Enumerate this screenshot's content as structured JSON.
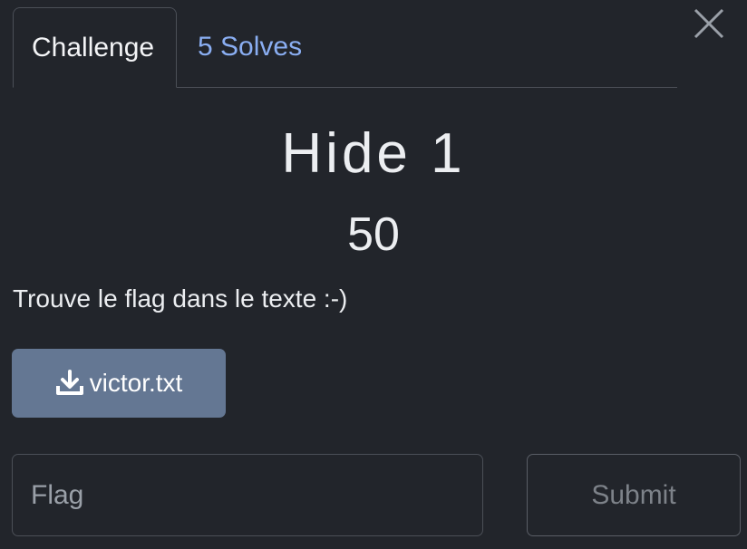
{
  "tabs": [
    {
      "label": "Challenge"
    },
    {
      "label": "5 Solves"
    }
  ],
  "challenge": {
    "name": "Hide 1",
    "points": "50",
    "description": "Trouve le flag dans le texte :-)"
  },
  "file": {
    "label": "victor.txt",
    "icon": "download-icon"
  },
  "form": {
    "flag_placeholder": "Flag",
    "submit_label": "Submit"
  },
  "colors": {
    "background": "#22252b",
    "link": "#8aaef2",
    "file_button": "#647793"
  }
}
